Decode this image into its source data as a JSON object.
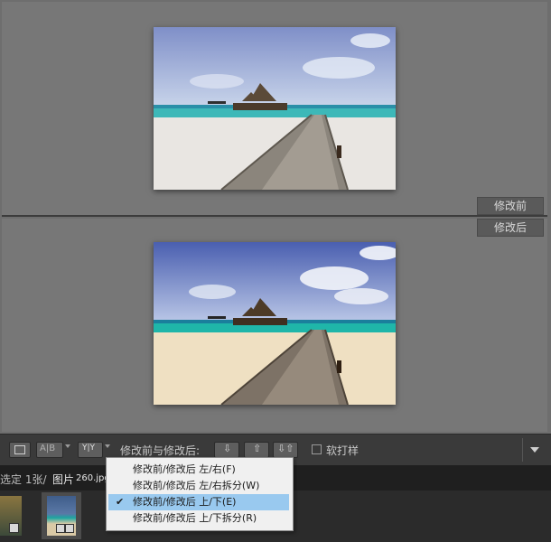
{
  "panes": {
    "before_label": "修改前",
    "after_label": "修改后"
  },
  "toolbar": {
    "ab_label": "A|B",
    "yy_label": "Y|Y",
    "mode_label": "修改前与修改后:",
    "softproof_label": "软打样"
  },
  "status": {
    "selected_text": "选定 1张/",
    "filename_prefix": "图片",
    "filename": "260.jpg"
  },
  "menu": {
    "items": [
      {
        "label": "修改前/修改后 左/右(F)",
        "checked": false
      },
      {
        "label": "修改前/修改后 左/右拆分(W)",
        "checked": false
      },
      {
        "label": "修改前/修改后 上/下(E)",
        "checked": true
      },
      {
        "label": "修改前/修改后 上/下拆分(R)",
        "checked": false
      }
    ],
    "check_glyph": "✔"
  },
  "colors": {
    "selection": "#99c9ef",
    "panel": "#777777",
    "toolbar": "#3a3a3a"
  }
}
